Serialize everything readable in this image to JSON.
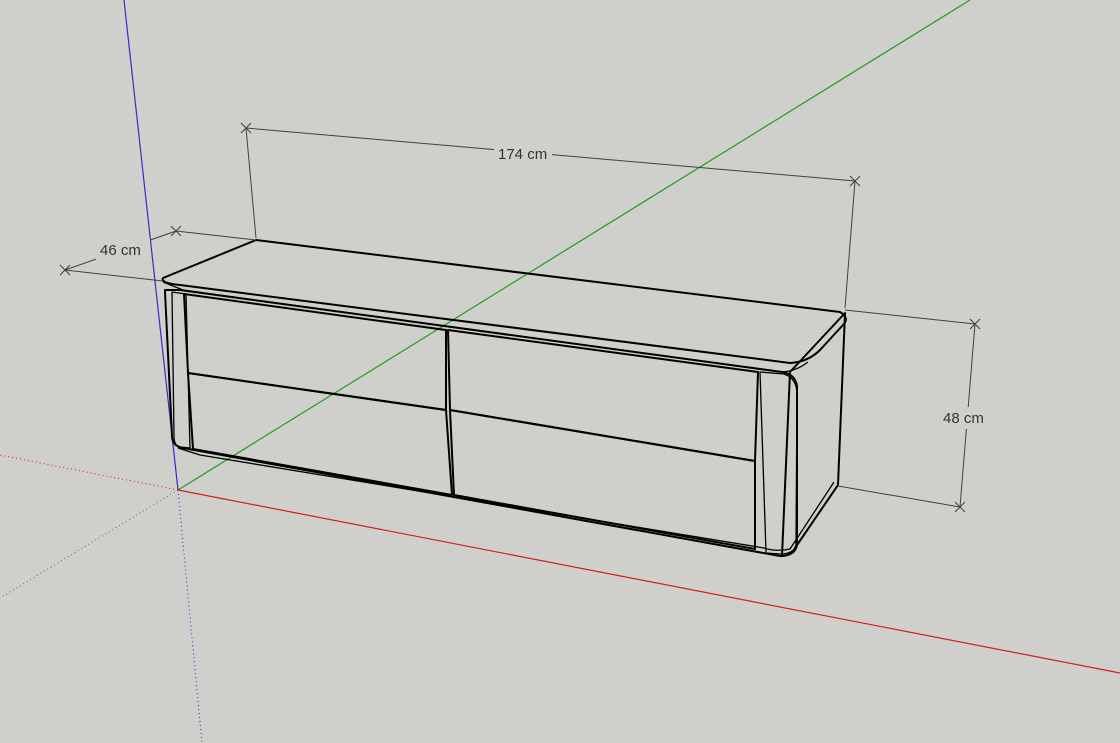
{
  "scene": {
    "background_color": "#cfcfcb",
    "axis_colors": {
      "red": "#d02020",
      "green": "#20a020",
      "blue": "#3030c0"
    },
    "object": "sideboard",
    "surface_colors": {
      "top": "#a8a8a8",
      "front": "#ffffff",
      "side": "#bcbcbc",
      "edge": "#000000"
    }
  },
  "dimensions": {
    "width_label": "174 cm",
    "depth_label": "46 cm",
    "height_label": "48 cm"
  }
}
